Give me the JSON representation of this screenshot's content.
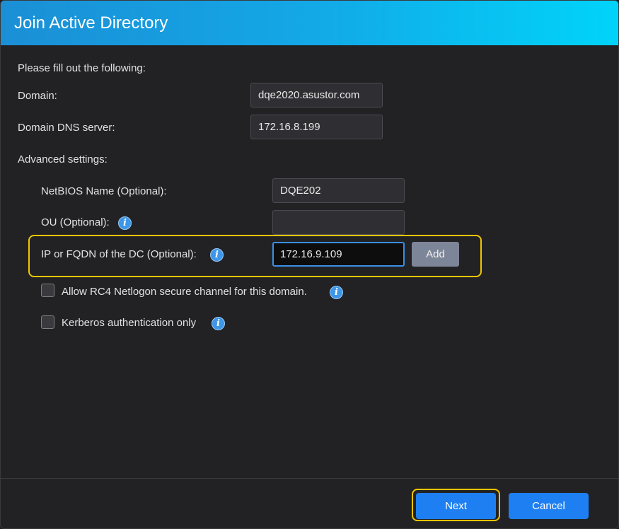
{
  "dialog": {
    "title": "Join Active Directory",
    "intro": "Please fill out the following:"
  },
  "form": {
    "domain_label": "Domain:",
    "domain_value": "dqe2020.asustor.com",
    "dns_label": "Domain DNS server:",
    "dns_value": "172.16.8.199",
    "advanced_label": "Advanced settings:",
    "netbios_label": "NetBIOS Name (Optional):",
    "netbios_value": "DQE202",
    "ou_label": "OU (Optional):",
    "ou_value": "",
    "dc_label": "IP or FQDN of the DC (Optional):",
    "dc_value": "172.16.9.109",
    "add_label": "Add",
    "rc4_label": "Allow RC4 Netlogon secure channel for this domain.",
    "rc4_checked": false,
    "kerberos_label": "Kerberos authentication only",
    "kerberos_checked": false,
    "info_glyph": "i"
  },
  "footer": {
    "next_label": "Next",
    "cancel_label": "Cancel"
  },
  "colors": {
    "title_gradient_start": "#1b8fd6",
    "title_gradient_end": "#00d4fa",
    "primary_button": "#1e7ff2",
    "highlight": "#f2c500",
    "background": "#222225"
  },
  "icons": {
    "info": "info-icon",
    "checkbox": "checkbox-unchecked"
  }
}
